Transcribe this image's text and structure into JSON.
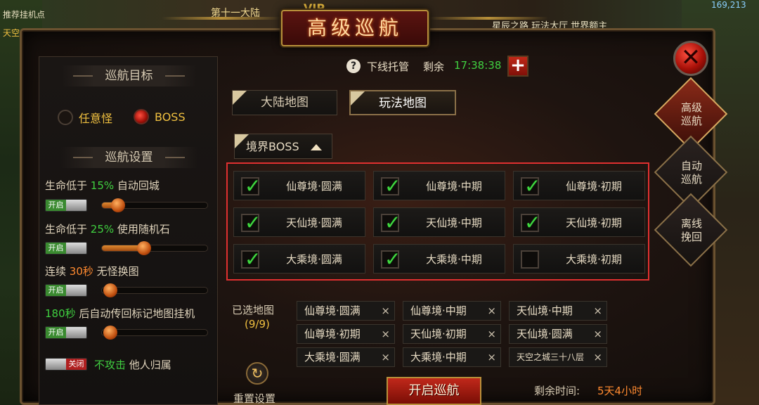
{
  "window": {
    "title": "高级巡航"
  },
  "target_section": {
    "heading": "巡航目标",
    "options": [
      {
        "label": "任意怪",
        "selected": false
      },
      {
        "label": "BOSS",
        "selected": true
      }
    ]
  },
  "settings_section": {
    "heading": "巡航设置",
    "rows": [
      {
        "prefix": "生命低于",
        "value": "15%",
        "suffix": "自动回城",
        "toggle": "开启",
        "slider_fraction": 0.15
      },
      {
        "prefix": "生命低于",
        "value": "25%",
        "suffix": "使用随机石",
        "toggle": "开启",
        "slider_fraction": 0.4
      },
      {
        "prefix": "连续",
        "value": "30秒",
        "suffix": "无怪换图",
        "toggle": "开启",
        "slider_fraction": 0.0
      },
      {
        "prefix": "",
        "value": "180秒",
        "suffix": "后自动传回标记地图挂机",
        "toggle": "开启",
        "slider_fraction": 0.0
      }
    ],
    "no_attack": {
      "toggle": "关闭",
      "highlight": "不攻击",
      "text": "他人归属"
    }
  },
  "offline": {
    "label": "下线托管",
    "remain_label": "剩余",
    "remain_time": "17:38:38",
    "add_symbol": "+"
  },
  "map_tabs": [
    {
      "label": "大陆地图",
      "active": false
    },
    {
      "label": "玩法地图",
      "active": true
    }
  ],
  "realm_dropdown": {
    "label": "境界BOSS"
  },
  "boss_grid": [
    {
      "name": "仙尊境·圆满",
      "checked": true
    },
    {
      "name": "仙尊境·中期",
      "checked": true
    },
    {
      "name": "仙尊境·初期",
      "checked": true
    },
    {
      "name": "天仙境·圆满",
      "checked": true
    },
    {
      "name": "天仙境·中期",
      "checked": true
    },
    {
      "name": "天仙境·初期",
      "checked": true
    },
    {
      "name": "大乘境·圆满",
      "checked": true
    },
    {
      "name": "大乘境·中期",
      "checked": true
    },
    {
      "name": "大乘境·初期",
      "checked": false
    }
  ],
  "selected_maps": {
    "label": "已选地图",
    "count": "(9/9)",
    "chips": [
      "仙尊境·圆满",
      "仙尊境·中期",
      "天仙境·中期",
      "仙尊境·初期",
      "天仙境·初期",
      "天仙境·圆满",
      "大乘境·圆满",
      "大乘境·中期",
      "天空之城三十八层"
    ],
    "remove_symbol": "×"
  },
  "footer": {
    "reset_label": "重置设置",
    "start_label": "开启巡航",
    "time_left_label": "剩余时间:",
    "time_left_value": "5天4小时"
  },
  "side_tabs": [
    {
      "label_1": "高级",
      "label_2": "巡航",
      "active": true
    },
    {
      "label_1": "自动",
      "label_2": "巡航",
      "active": false
    },
    {
      "label_1": "离线",
      "label_2": "挽回",
      "active": false
    }
  ],
  "background": {
    "top_left": "推荐挂机点",
    "tower": "天空之城三十八层]",
    "banner": "第十一大陆",
    "vip": "VIP",
    "top_links": "星辰之路  玩法大厅  世界额主",
    "coords": "169,213"
  }
}
